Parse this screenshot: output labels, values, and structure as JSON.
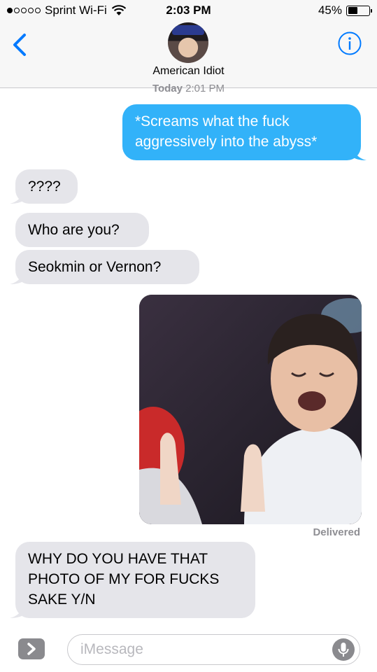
{
  "status_bar": {
    "carrier": "Sprint Wi-Fi",
    "time": "2:03 PM",
    "battery": "45%",
    "battery_level": 0.45
  },
  "header": {
    "contact_name": "American Idiot",
    "back_icon": "chevron-left-icon",
    "info_icon": "info-icon"
  },
  "timestamp": {
    "day": "Today",
    "time": "2:01 PM"
  },
  "messages": [
    {
      "from": "me",
      "text": "*Screams what the fuck aggressively into the abyss*"
    },
    {
      "from": "them",
      "text": "????"
    },
    {
      "from": "them",
      "text": "Who are you?"
    },
    {
      "from": "them",
      "text": "Seokmin or Vernon?"
    },
    {
      "from": "me",
      "type": "photo"
    },
    {
      "from": "them",
      "text": "WHY DO YOU HAVE THAT PHOTO OF MY FOR FUCKS SAKE Y/N"
    }
  ],
  "delivery_status": "Delivered",
  "composer": {
    "placeholder": "iMessage",
    "expand_icon": "chevron-right-icon",
    "mic_icon": "microphone-icon"
  },
  "colors": {
    "outgoing_bubble": "#32b2f9",
    "incoming_bubble": "#e5e5ea",
    "accent": "#007aff"
  }
}
